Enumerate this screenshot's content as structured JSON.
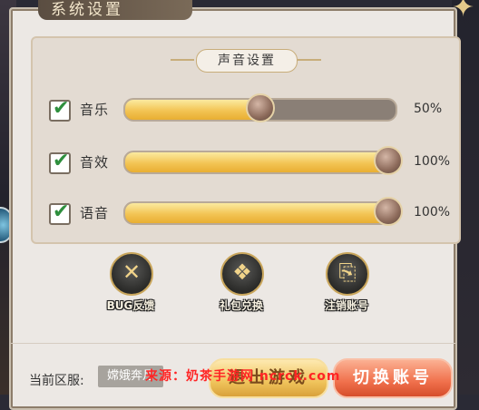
{
  "window": {
    "title": "系统设置"
  },
  "sound_section": {
    "title": "声音设置"
  },
  "rows": [
    {
      "label": "音乐",
      "checked": true,
      "value": 0.5,
      "value_text": "50%"
    },
    {
      "label": "音效",
      "checked": true,
      "value": 1.0,
      "value_text": "100%"
    },
    {
      "label": "语音",
      "checked": true,
      "value": 1.0,
      "value_text": "100%"
    }
  ],
  "actions": [
    {
      "label": "BUG反馈",
      "icon": "wrench-screwdriver-icon"
    },
    {
      "label": "礼包兑换",
      "icon": "gift-icon"
    },
    {
      "label": "注销账号",
      "icon": "logout-door-icon"
    }
  ],
  "footer": {
    "server_label": "当前区服:",
    "server_name": "嫦娥奔月",
    "exit_button": "退出游戏",
    "switch_button": "切换账号"
  },
  "watermark": "来源：奶茶手游网 ncrck.com",
  "colors": {
    "accent": "#f3c454",
    "check": "#2e8f3d",
    "switch_button": "#f0704c"
  }
}
